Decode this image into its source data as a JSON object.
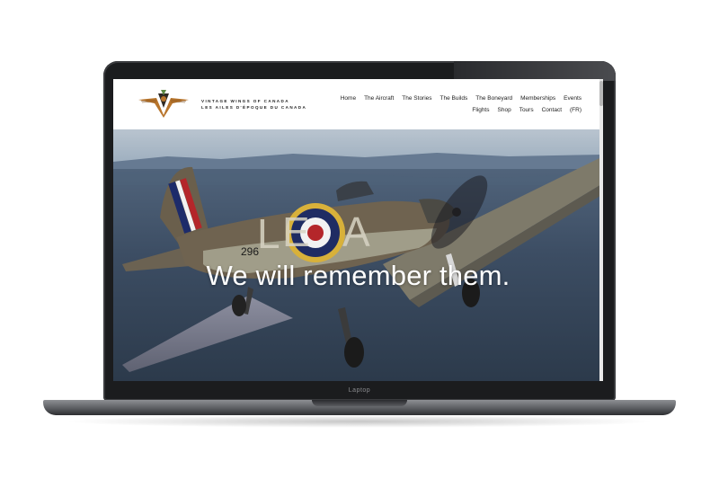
{
  "device": {
    "bezel_label": "Laptop"
  },
  "site": {
    "logo_icon": "winged-v-emblem-icon",
    "brand_line_1": "VINTAGE WINGS OF CANADA",
    "brand_line_2": "LES AILES D'ÉPOQUE DU CANADA"
  },
  "nav": {
    "row1": [
      "Home",
      "The Aircraft",
      "The Stories",
      "The Builds",
      "The Boneyard",
      "Memberships",
      "Events"
    ],
    "row2": [
      "Flights",
      "Shop",
      "Tours",
      "Contact",
      "(FR)"
    ]
  },
  "hero": {
    "title": "We will remember them.",
    "aircraft_code": "LE A",
    "serial": "P3296",
    "image_icon": "hurricane-fighter-plane-photo"
  },
  "colors": {
    "sky": "#aab8c6",
    "mountains": "#465a72",
    "fuselage": "#6f6350",
    "roundel_yellow": "#d8b13a",
    "roundel_blue": "#1f2c63",
    "roundel_red": "#b4262a"
  }
}
